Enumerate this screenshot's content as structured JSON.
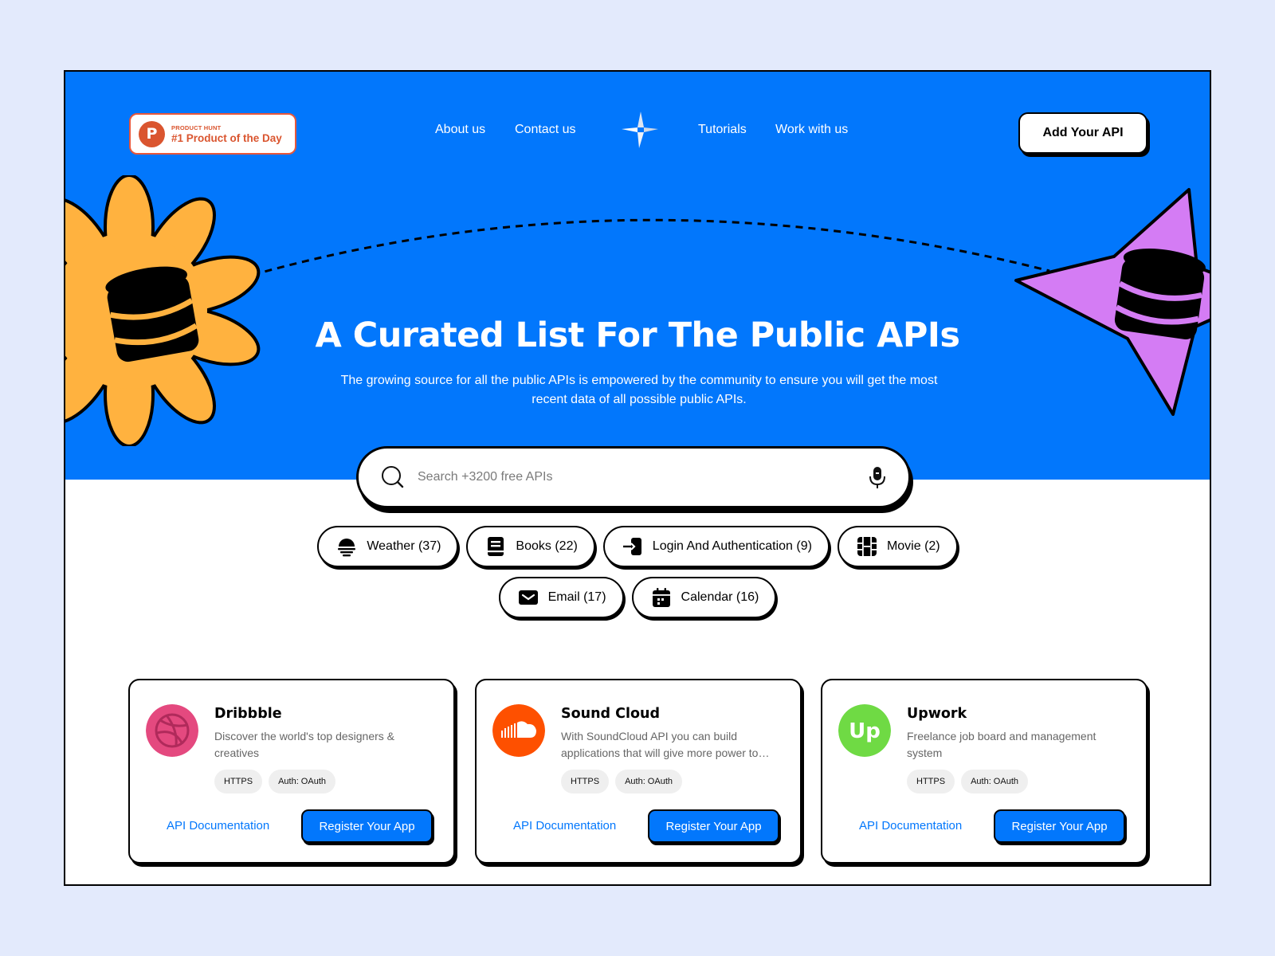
{
  "header": {
    "badge": {
      "kicker": "PRODUCT HUNT",
      "title": "#1 Product of the Day",
      "logo_letter": "P"
    },
    "nav": {
      "about": "About us",
      "contact": "Contact us",
      "tutorials": "Tutorials",
      "work": "Work with us"
    },
    "cta": "Add Your API"
  },
  "hero": {
    "title": "A Curated List For The Public APIs",
    "subtitle": "The growing source for all the public APIs is empowered by the community to ensure you will get the most recent data of all possible public APIs."
  },
  "search": {
    "placeholder": "Search +3200 free APIs",
    "value": ""
  },
  "categories": [
    {
      "label": "Weather (37)",
      "icon": "weather-icon"
    },
    {
      "label": "Books (22)",
      "icon": "book-icon"
    },
    {
      "label": "Login And Authentication (9)",
      "icon": "login-icon"
    },
    {
      "label": "Movie (2)",
      "icon": "film-icon"
    },
    {
      "label": "Email (17)",
      "icon": "email-icon"
    },
    {
      "label": "Calendar (16)",
      "icon": "calendar-icon"
    }
  ],
  "cards": [
    {
      "name": "Dribbble",
      "description": "Discover the world's top designers & creatives",
      "tags": [
        "HTTPS",
        "Auth: OAuth"
      ],
      "doc_link": "API Documentation",
      "register": "Register Your App",
      "logo": "dribbble-logo",
      "brand_color": "#e4497f"
    },
    {
      "name": "Sound Cloud",
      "description": "With SoundCloud API you can build applications that will give more power to…",
      "tags": [
        "HTTPS",
        "Auth: OAuth"
      ],
      "doc_link": "API Documentation",
      "register": "Register Your App",
      "logo": "soundcloud-logo",
      "brand_color": "#fe5000"
    },
    {
      "name": "Upwork",
      "description": "Freelance job board and management system",
      "tags": [
        "HTTPS",
        "Auth: OAuth"
      ],
      "doc_link": "API Documentation",
      "register": "Register Your App",
      "logo": "upwork-logo",
      "brand_color": "#6fda44",
      "logo_text": "Up"
    }
  ],
  "colors": {
    "page_background": "#e3eafc",
    "hero_blue": "#0277fc",
    "flower_yellow": "#ffb23f",
    "star_purple": "#d47cf4",
    "producthunt_orange": "#da552f"
  }
}
